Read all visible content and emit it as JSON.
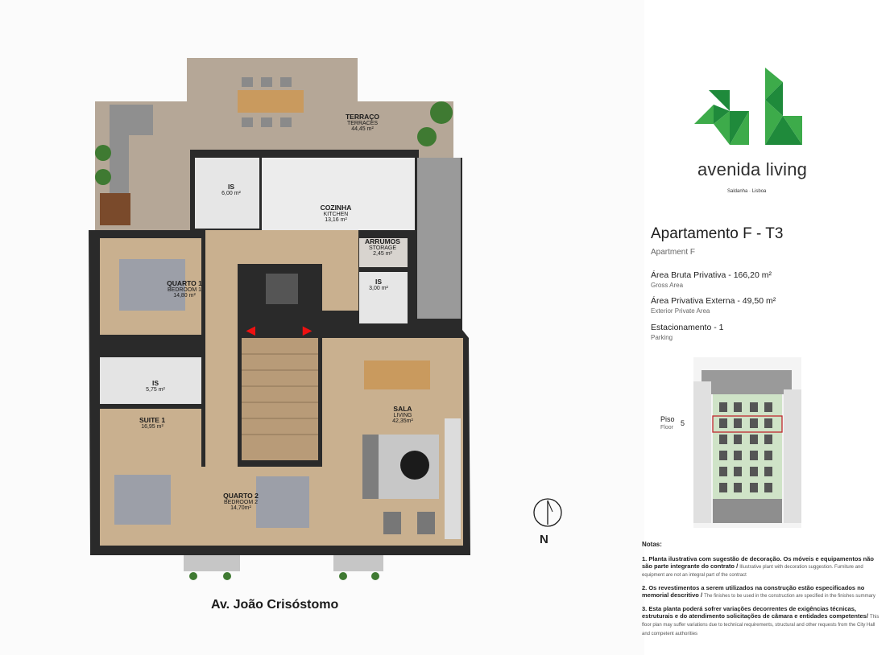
{
  "brand": {
    "name": "avenida living",
    "location": "Saldanha · Lisboa",
    "colors": {
      "green_dark": "#1f8a3b",
      "green_light": "#3dab4a"
    }
  },
  "apartment": {
    "title": "Apartamento F  - T3",
    "subtitle": "Apartment F"
  },
  "specs": [
    {
      "label": "Área Bruta Privativa - 166,20 m²",
      "sub": "Gross Area"
    },
    {
      "label": "Área Privativa Externa - 49,50 m²",
      "sub": "Exterior Private Area"
    },
    {
      "label": "Estacionamento - 1",
      "sub": "Parking"
    }
  ],
  "floor": {
    "label": "Piso",
    "sub": "Floor",
    "number": "5"
  },
  "rooms": {
    "terraco": {
      "name": "TERRAÇO",
      "en": "TERRACES",
      "area": "44,45 m²"
    },
    "is1": {
      "name": "IS",
      "area": "6,00 m²"
    },
    "cozinha": {
      "name": "COZINHA",
      "en": "KITCHEN",
      "area": "13,16 m²"
    },
    "arrumos": {
      "name": "ARRUMOS",
      "en": "STORAGE",
      "area": "2,45 m²"
    },
    "is2": {
      "name": "IS",
      "area": "3,00 m²"
    },
    "quarto1": {
      "name": "QUARTO 1",
      "en": "BEDROOM 1",
      "area": "14,80 m²"
    },
    "is3": {
      "name": "IS",
      "area": "5,75 m²"
    },
    "suite1": {
      "name": "SUITE 1",
      "area": "16,95 m²"
    },
    "sala": {
      "name": "SALA",
      "en": "LIVING",
      "area": "42,35m²"
    },
    "quarto2": {
      "name": "QUARTO 2",
      "en": "BEDROOM 2",
      "area": "14,70m²"
    }
  },
  "street": "Av. João Crisóstomo",
  "compass": {
    "letter": "N"
  },
  "notes": {
    "heading": "Notas:",
    "items": [
      {
        "pt": "1. Planta ilustrativa com sugestão de decoração. Os móveis e equipamentos não são parte integrante do contrato /",
        "en": "Illustrative plant with decoration suggestion. Furniture and equipment are not an integral part of the contract"
      },
      {
        "pt": "2. Os revestimentos a serem utilizados na construção estão especificados no memorial descritivo /",
        "en": "The finishes to be used in the construction are specified in the finishes summary"
      },
      {
        "pt": "3. Esta planta poderá sofrer variações decorrentes de exigências técnicas, estruturais e do atendimento solicitações de câmara e entidades competentes/",
        "en": "This floor plan may suffer variations due to technical requirements, structural and other requests from the City Hall and competent authorities"
      }
    ]
  }
}
